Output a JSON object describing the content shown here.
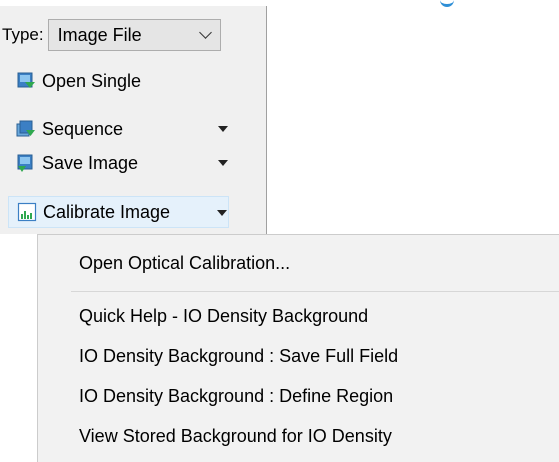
{
  "toolbar": {
    "type_label": "Type:",
    "type_value": "Image File",
    "items": [
      {
        "label": "Open Single",
        "icon": "open-single-icon",
        "has_dropdown": false
      },
      {
        "label": "Sequence",
        "icon": "sequence-icon",
        "has_dropdown": true
      },
      {
        "label": "Save Image",
        "icon": "save-image-icon",
        "has_dropdown": true
      },
      {
        "label": "Calibrate Image",
        "icon": "calibrate-image-icon",
        "has_dropdown": true,
        "active": true
      }
    ]
  },
  "menu": {
    "items": [
      "Open Optical Calibration...",
      "Quick Help - IO Density Background",
      "IO Density Background : Save Full Field",
      "IO Density Background : Define Region",
      "View Stored Background for IO Density"
    ]
  },
  "colors": {
    "panel_bg": "#f0f0f0",
    "menu_bg": "#f2f2f2",
    "highlight_bg": "#e5f1fb",
    "accent": "#2e8fd6"
  }
}
